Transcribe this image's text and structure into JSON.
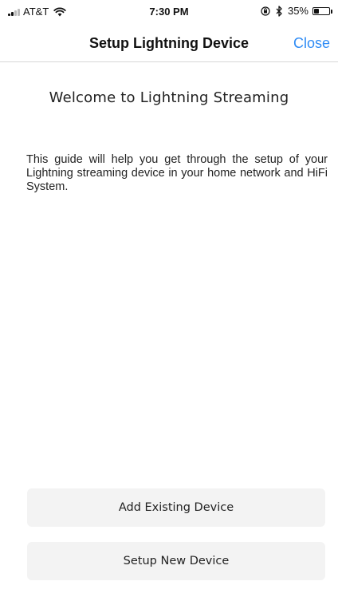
{
  "status_bar": {
    "carrier": "AT&T",
    "time": "7:30 PM",
    "battery": "35%",
    "battery_level": 0.35
  },
  "nav": {
    "title": "Setup Lightning Device",
    "close_label": "Close"
  },
  "content": {
    "heading": "Welcome to Lightning Streaming",
    "intro": "This guide will help you get through the setup of your Lightning streaming device in your home network and HiFi System."
  },
  "actions": {
    "add_existing_label": "Add Existing Device",
    "setup_new_label": "Setup New Device"
  },
  "colors": {
    "accent": "#2f8cf5",
    "button_bg": "#f3f3f3"
  }
}
